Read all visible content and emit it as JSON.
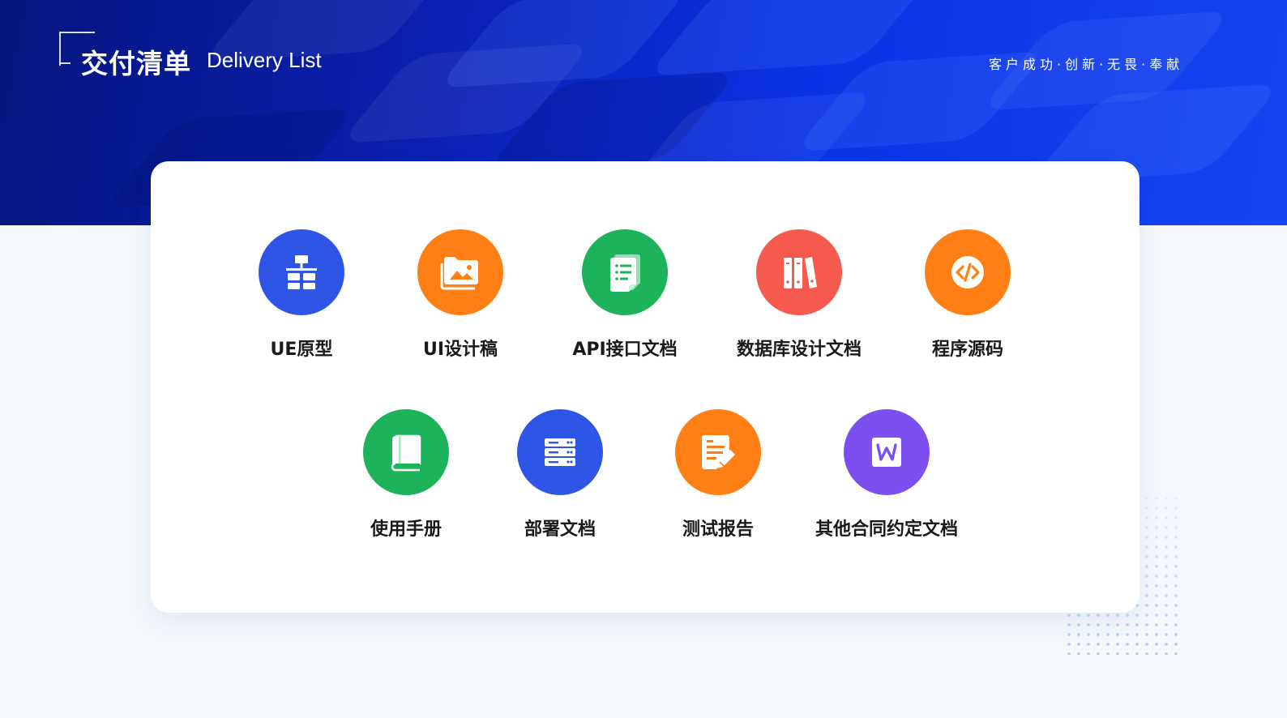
{
  "header": {
    "title": "交付清单",
    "subtitle": "Delivery List",
    "slogan": "客户成功·创新·无畏·奉献"
  },
  "items": [
    {
      "label": "UE原型",
      "icon": "sitemap-icon",
      "color": "#2f55e6"
    },
    {
      "label": "UI设计稿",
      "icon": "image-folder-icon",
      "color": "#ff7f14"
    },
    {
      "label": "API接口文档",
      "icon": "document-list-icon",
      "color": "#1cb35a"
    },
    {
      "label": "数据库设计文档",
      "icon": "binders-icon",
      "color": "#f65a4f"
    },
    {
      "label": "程序源码",
      "icon": "code-icon",
      "color": "#ff7f14"
    },
    {
      "label": "使用手册",
      "icon": "book-icon",
      "color": "#1cb35a"
    },
    {
      "label": "部署文档",
      "icon": "server-icon",
      "color": "#2f55e6"
    },
    {
      "label": "测试报告",
      "icon": "report-edit-icon",
      "color": "#ff7f14"
    },
    {
      "label": "其他合同约定文档",
      "icon": "word-doc-icon",
      "color": "#7b4ff0"
    }
  ]
}
